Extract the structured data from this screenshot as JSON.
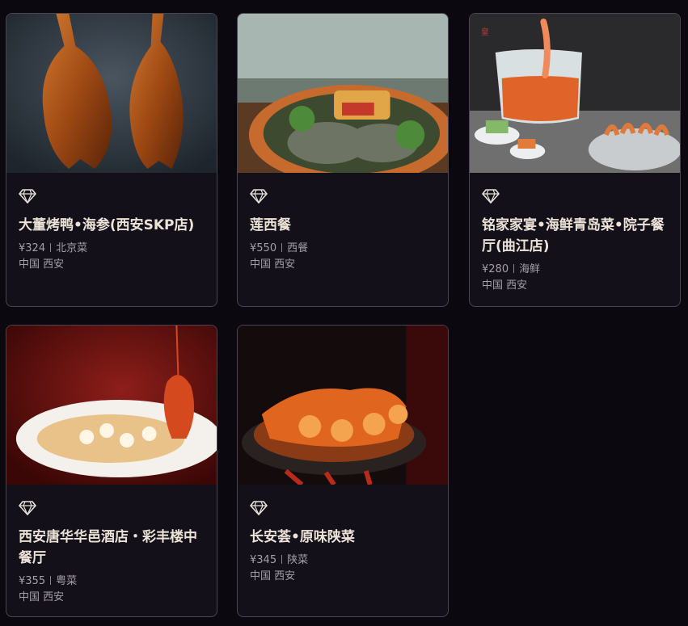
{
  "restaurants": [
    {
      "name": "大董烤鸭•海参(西安SKP店)",
      "price": "¥324",
      "cuisine": "北京菜",
      "location": "中国 西安",
      "image": "roast-duck-photo",
      "icon": "diamond-icon"
    },
    {
      "name": "莲西餐",
      "price": "¥550",
      "cuisine": "西餐",
      "location": "中国 西安",
      "image": "seafood-platter-photo",
      "icon": "diamond-icon"
    },
    {
      "name": "铭家家宴•海鲜青岛菜•院子餐厅(曲江店)",
      "price": "¥280",
      "cuisine": "海鲜",
      "location": "中国 西安",
      "image": "shrimp-hotpot-photo",
      "icon": "diamond-icon"
    },
    {
      "name": "西安唐华华邑酒店・彩丰楼中餐厅",
      "price": "¥355",
      "cuisine": "粤菜",
      "location": "中国 西安",
      "image": "lobster-dish-photo",
      "icon": "diamond-icon"
    },
    {
      "name": "长安荟•原味陕菜",
      "price": "¥345",
      "cuisine": "陕菜",
      "location": "中国 西安",
      "image": "crayfish-grill-photo",
      "icon": "diamond-icon"
    }
  ],
  "colors": {
    "background": "#0c0810",
    "card": "#141019",
    "title": "#ece3d8",
    "meta": "#a59fa8"
  }
}
